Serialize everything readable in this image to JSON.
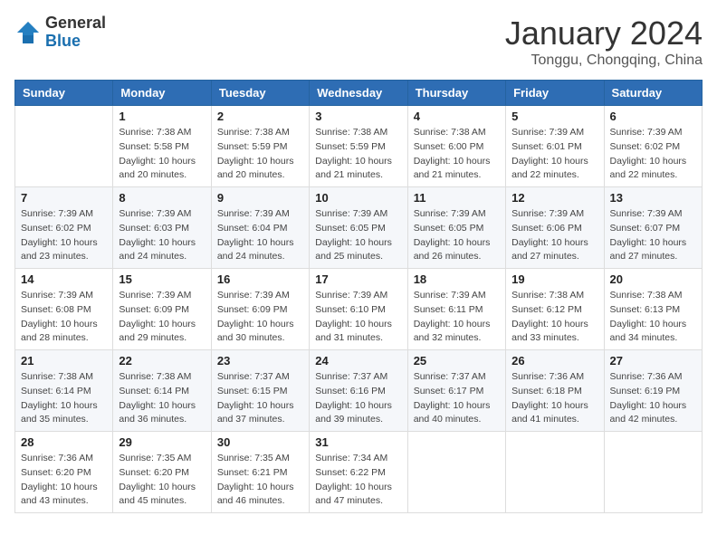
{
  "header": {
    "logo_general": "General",
    "logo_blue": "Blue",
    "month_title": "January 2024",
    "location": "Tonggu, Chongqing, China"
  },
  "days_of_week": [
    "Sunday",
    "Monday",
    "Tuesday",
    "Wednesday",
    "Thursday",
    "Friday",
    "Saturday"
  ],
  "weeks": [
    [
      {
        "num": "",
        "info": ""
      },
      {
        "num": "1",
        "info": "Sunrise: 7:38 AM\nSunset: 5:58 PM\nDaylight: 10 hours\nand 20 minutes."
      },
      {
        "num": "2",
        "info": "Sunrise: 7:38 AM\nSunset: 5:59 PM\nDaylight: 10 hours\nand 20 minutes."
      },
      {
        "num": "3",
        "info": "Sunrise: 7:38 AM\nSunset: 5:59 PM\nDaylight: 10 hours\nand 21 minutes."
      },
      {
        "num": "4",
        "info": "Sunrise: 7:38 AM\nSunset: 6:00 PM\nDaylight: 10 hours\nand 21 minutes."
      },
      {
        "num": "5",
        "info": "Sunrise: 7:39 AM\nSunset: 6:01 PM\nDaylight: 10 hours\nand 22 minutes."
      },
      {
        "num": "6",
        "info": "Sunrise: 7:39 AM\nSunset: 6:02 PM\nDaylight: 10 hours\nand 22 minutes."
      }
    ],
    [
      {
        "num": "7",
        "info": "Sunrise: 7:39 AM\nSunset: 6:02 PM\nDaylight: 10 hours\nand 23 minutes."
      },
      {
        "num": "8",
        "info": "Sunrise: 7:39 AM\nSunset: 6:03 PM\nDaylight: 10 hours\nand 24 minutes."
      },
      {
        "num": "9",
        "info": "Sunrise: 7:39 AM\nSunset: 6:04 PM\nDaylight: 10 hours\nand 24 minutes."
      },
      {
        "num": "10",
        "info": "Sunrise: 7:39 AM\nSunset: 6:05 PM\nDaylight: 10 hours\nand 25 minutes."
      },
      {
        "num": "11",
        "info": "Sunrise: 7:39 AM\nSunset: 6:05 PM\nDaylight: 10 hours\nand 26 minutes."
      },
      {
        "num": "12",
        "info": "Sunrise: 7:39 AM\nSunset: 6:06 PM\nDaylight: 10 hours\nand 27 minutes."
      },
      {
        "num": "13",
        "info": "Sunrise: 7:39 AM\nSunset: 6:07 PM\nDaylight: 10 hours\nand 27 minutes."
      }
    ],
    [
      {
        "num": "14",
        "info": "Sunrise: 7:39 AM\nSunset: 6:08 PM\nDaylight: 10 hours\nand 28 minutes."
      },
      {
        "num": "15",
        "info": "Sunrise: 7:39 AM\nSunset: 6:09 PM\nDaylight: 10 hours\nand 29 minutes."
      },
      {
        "num": "16",
        "info": "Sunrise: 7:39 AM\nSunset: 6:09 PM\nDaylight: 10 hours\nand 30 minutes."
      },
      {
        "num": "17",
        "info": "Sunrise: 7:39 AM\nSunset: 6:10 PM\nDaylight: 10 hours\nand 31 minutes."
      },
      {
        "num": "18",
        "info": "Sunrise: 7:39 AM\nSunset: 6:11 PM\nDaylight: 10 hours\nand 32 minutes."
      },
      {
        "num": "19",
        "info": "Sunrise: 7:38 AM\nSunset: 6:12 PM\nDaylight: 10 hours\nand 33 minutes."
      },
      {
        "num": "20",
        "info": "Sunrise: 7:38 AM\nSunset: 6:13 PM\nDaylight: 10 hours\nand 34 minutes."
      }
    ],
    [
      {
        "num": "21",
        "info": "Sunrise: 7:38 AM\nSunset: 6:14 PM\nDaylight: 10 hours\nand 35 minutes."
      },
      {
        "num": "22",
        "info": "Sunrise: 7:38 AM\nSunset: 6:14 PM\nDaylight: 10 hours\nand 36 minutes."
      },
      {
        "num": "23",
        "info": "Sunrise: 7:37 AM\nSunset: 6:15 PM\nDaylight: 10 hours\nand 37 minutes."
      },
      {
        "num": "24",
        "info": "Sunrise: 7:37 AM\nSunset: 6:16 PM\nDaylight: 10 hours\nand 39 minutes."
      },
      {
        "num": "25",
        "info": "Sunrise: 7:37 AM\nSunset: 6:17 PM\nDaylight: 10 hours\nand 40 minutes."
      },
      {
        "num": "26",
        "info": "Sunrise: 7:36 AM\nSunset: 6:18 PM\nDaylight: 10 hours\nand 41 minutes."
      },
      {
        "num": "27",
        "info": "Sunrise: 7:36 AM\nSunset: 6:19 PM\nDaylight: 10 hours\nand 42 minutes."
      }
    ],
    [
      {
        "num": "28",
        "info": "Sunrise: 7:36 AM\nSunset: 6:20 PM\nDaylight: 10 hours\nand 43 minutes."
      },
      {
        "num": "29",
        "info": "Sunrise: 7:35 AM\nSunset: 6:20 PM\nDaylight: 10 hours\nand 45 minutes."
      },
      {
        "num": "30",
        "info": "Sunrise: 7:35 AM\nSunset: 6:21 PM\nDaylight: 10 hours\nand 46 minutes."
      },
      {
        "num": "31",
        "info": "Sunrise: 7:34 AM\nSunset: 6:22 PM\nDaylight: 10 hours\nand 47 minutes."
      },
      {
        "num": "",
        "info": ""
      },
      {
        "num": "",
        "info": ""
      },
      {
        "num": "",
        "info": ""
      }
    ]
  ]
}
